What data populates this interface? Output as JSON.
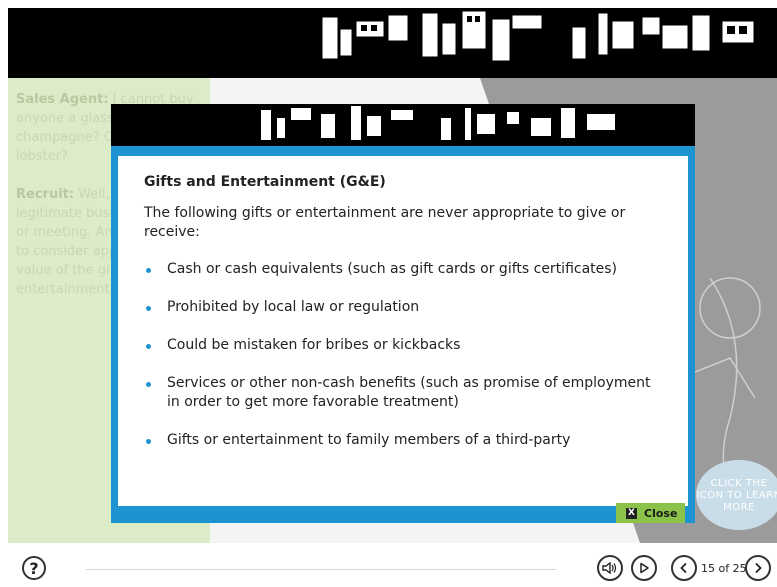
{
  "background_text": {
    "sales_agent_label": "Sales Agent:",
    "sales_agent_text": "I cannot buy anyone a glass of champagne? Or treat to a lobster?",
    "recruit_label": "Recruit:",
    "recruit_text": "Well, has to be a legitimate business purpose or meeting. And, important to consider appearance and value of the gift or entertainment."
  },
  "learn_more": "CLICK THE ICON TO LEARN MORE",
  "modal": {
    "title": "Gifts and Entertainment (G&E)",
    "intro": "The following gifts or entertainment are never appropriate to give or receive:",
    "bullets": [
      "Cash or cash equivalents (such as gift cards or gifts certificates)",
      "Prohibited by local law or regulation",
      "Could be mistaken for bribes or kickbacks",
      "Services or other non-cash benefits (such as promise of employment in order to get more favorable treatment)",
      "Gifts or entertainment to family members of a third-party"
    ],
    "close_label": "Close",
    "close_icon_glyph": "X"
  },
  "controls": {
    "help_glyph": "?",
    "page_count": "15 of 25"
  },
  "colors": {
    "accent_blue": "#1d93cf",
    "close_green": "#8bc34a",
    "panel_green": "#dcecc8"
  }
}
